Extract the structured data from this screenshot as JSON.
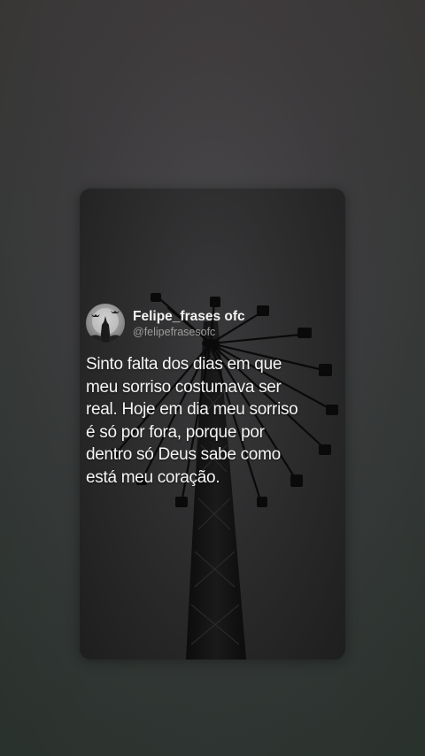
{
  "post": {
    "display_name": "Felipe_frases ofc",
    "handle": "@felipefrasesofc",
    "avatar_icon": "moon-bats-avatar-icon",
    "quote_lines": [
      "Sinto falta dos dias em que",
      "meu sorriso costumava ser",
      "real. Hoje em dia meu sorriso",
      "é só por fora, porque por",
      "dentro só Deus sabe como",
      "está meu coração."
    ]
  },
  "background_image": "swing-ride-tower-silhouette",
  "colors": {
    "page_background": "#3c3c3e",
    "card_background": "#2a2a2b",
    "text_primary": "#f5f5f5",
    "text_secondary": "#9c9c9c"
  }
}
